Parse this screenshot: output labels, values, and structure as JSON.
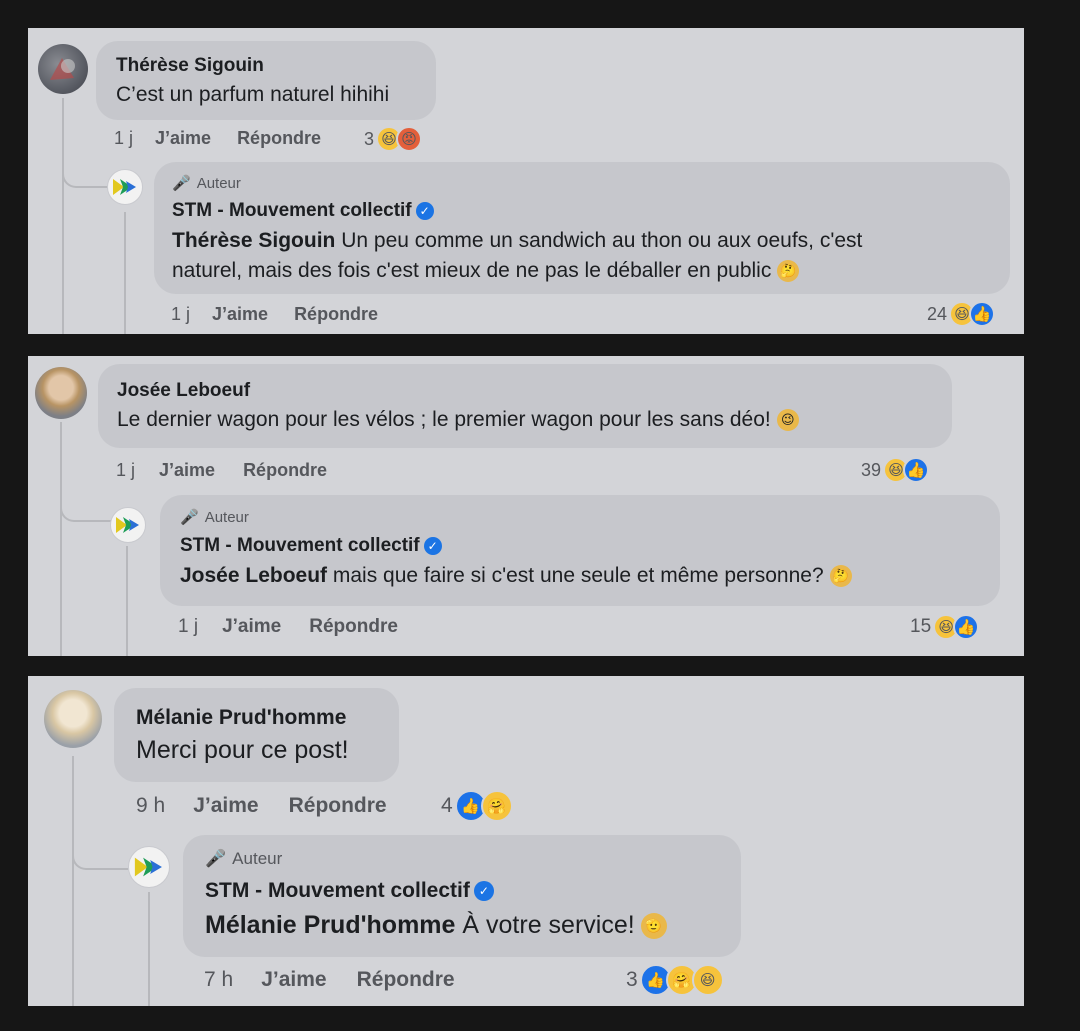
{
  "threads": [
    {
      "comment": {
        "author": "Thérèse Sigouin",
        "text": "C’est un parfum naturel hihihi",
        "time": "1 j",
        "like": "J’aime",
        "reply": "Répondre",
        "reaction_count": "3",
        "reactions": [
          "haha",
          "angry"
        ]
      },
      "reply": {
        "badge": "Auteur",
        "author": "STM - Mouvement collectif",
        "mention": "Thérèse Sigouin",
        "text_line1": " Un peu comme un sandwich au thon ou aux oeufs, c'est",
        "text_line2": "naturel, mais des fois c'est mieux de ne pas le déballer en public",
        "emoji": "thinking",
        "time": "1 j",
        "like": "J’aime",
        "reply": "Répondre",
        "reaction_count": "24",
        "reactions": [
          "haha",
          "like"
        ]
      }
    },
    {
      "comment": {
        "author": "Josée Leboeuf",
        "text": "Le dernier wagon pour les vélos ; le premier wagon pour les sans déo!",
        "emoji": "wink",
        "time": "1 j",
        "like": "J’aime",
        "reply": "Répondre",
        "reaction_count": "39",
        "reactions": [
          "haha",
          "like"
        ]
      },
      "reply": {
        "badge": "Auteur",
        "author": "STM - Mouvement collectif",
        "mention": "Josée Leboeuf",
        "text": " mais que faire si c'est une seule et même personne?",
        "emoji": "thinking",
        "time": "1 j",
        "like": "J’aime",
        "reply": "Répondre",
        "reaction_count": "15",
        "reactions": [
          "haha",
          "like"
        ]
      }
    },
    {
      "comment": {
        "author": "Mélanie Prud'homme",
        "text": "Merci pour ce post!",
        "time": "9 h",
        "like": "J’aime",
        "reply": "Répondre",
        "reaction_count": "4",
        "reactions": [
          "like",
          "care"
        ]
      },
      "reply": {
        "badge": "Auteur",
        "author": "STM - Mouvement collectif",
        "mention": "Mélanie Prud'homme",
        "text": " À votre service!",
        "emoji": "salute",
        "time": "7 h",
        "like": "J’aime",
        "reply": "Répondre",
        "reaction_count": "3",
        "reactions": [
          "like",
          "care",
          "haha"
        ]
      }
    }
  ],
  "colors": {
    "background": "#161616",
    "panel": "#d3d4d8",
    "bubble": "#c6c7cc",
    "verified": "#1b74e4",
    "like": "#1d72e8",
    "haha": "#f6c33c",
    "angry": "#e35f3b"
  }
}
